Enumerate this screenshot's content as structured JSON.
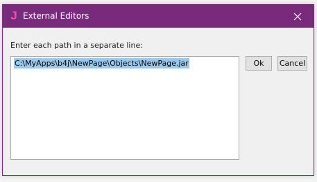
{
  "window": {
    "title": "External Editors",
    "app_icon_glyph": "J",
    "title_bar_color": "#7a2a7d",
    "app_icon_color": "#ff4fb0",
    "close_icon": "close-icon"
  },
  "dialog": {
    "prompt": "Enter each path in a separate line:",
    "paths": [
      "C:\\MyApps\\b4j\\NewPage\\Objects\\NewPage.jar"
    ],
    "selection_color": "#99c9ef",
    "ok_label": "Ok",
    "cancel_label": "Cancel"
  }
}
